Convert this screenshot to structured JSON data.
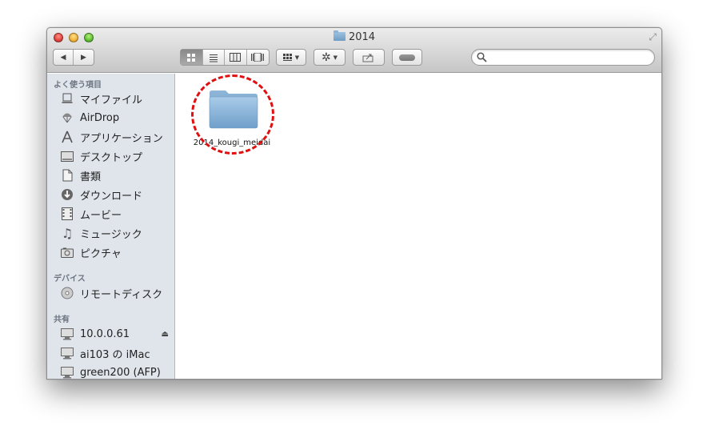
{
  "window": {
    "title": "2014"
  },
  "toolbar": {
    "nav_back": "◀",
    "nav_forward": "▶",
    "view_modes": [
      "icon-view",
      "list-view",
      "column-view",
      "coverflow-view"
    ],
    "search": {
      "placeholder": "",
      "value": ""
    }
  },
  "sidebar": {
    "favorites_header": "よく使う項目",
    "favorites": [
      {
        "label": "マイファイル",
        "icon": "all-my-files-icon"
      },
      {
        "label": "AirDrop",
        "icon": "airdrop-icon"
      },
      {
        "label": "アプリケーション",
        "icon": "applications-icon"
      },
      {
        "label": "デスクトップ",
        "icon": "desktop-icon"
      },
      {
        "label": "書類",
        "icon": "documents-icon"
      },
      {
        "label": "ダウンロード",
        "icon": "downloads-icon"
      },
      {
        "label": "ムービー",
        "icon": "movies-icon"
      },
      {
        "label": "ミュージック",
        "icon": "music-icon"
      },
      {
        "label": "ピクチャ",
        "icon": "pictures-icon"
      }
    ],
    "devices_header": "デバイス",
    "devices": [
      {
        "label": "リモートディスク",
        "icon": "remote-disc-icon"
      }
    ],
    "shared_header": "共有",
    "shared": [
      {
        "label": "10.0.0.61",
        "icon": "server-icon",
        "eject": "⏏"
      },
      {
        "label": "ai103 の iMac",
        "icon": "imac-icon"
      },
      {
        "label": "green200 (AFP)",
        "icon": "server-icon"
      }
    ]
  },
  "content": {
    "items": [
      {
        "name": "2014_kougi_meidai",
        "type": "folder"
      }
    ],
    "highlight_color": "#e01010"
  },
  "colors": {
    "folder": "#8fb6d8",
    "sidebar_bg": "#e0e5ec"
  }
}
